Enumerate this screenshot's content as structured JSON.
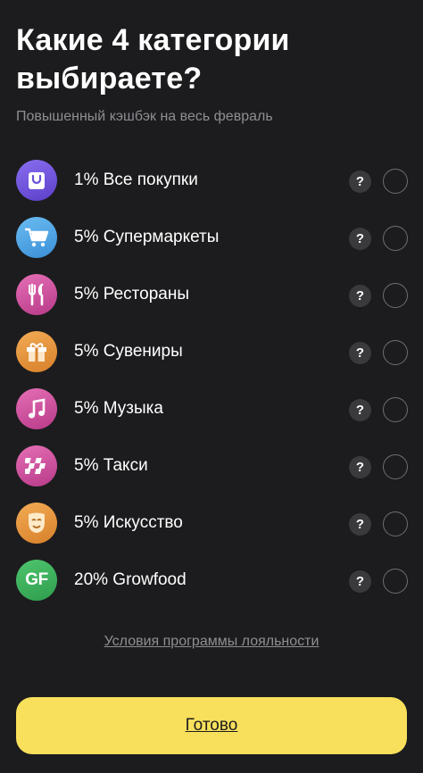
{
  "header": {
    "title": "Какие 4 категории выбираете?",
    "subtitle": "Повышенный кэшбэк на весь февраль"
  },
  "categories": [
    {
      "label": "1% Все покупки",
      "icon": "shopping-bag-icon",
      "color": "#6a4fd8"
    },
    {
      "label": "5% Супермаркеты",
      "icon": "cart-icon",
      "color": "#4aa3e6"
    },
    {
      "label": "5% Рестораны",
      "icon": "fork-knife-icon",
      "color": "#d24f9f"
    },
    {
      "label": "5% Сувениры",
      "icon": "gift-icon",
      "color": "#e69434"
    },
    {
      "label": "5% Музыка",
      "icon": "music-note-icon",
      "color": "#d24f9f"
    },
    {
      "label": "5% Такси",
      "icon": "taxi-checker-icon",
      "color": "#d24f9f"
    },
    {
      "label": "5% Искусство",
      "icon": "theater-mask-icon",
      "color": "#e69434"
    },
    {
      "label": "20% Growfood",
      "icon": "growfood-logo-icon",
      "icon_text": "GF",
      "color": "#3db35d"
    }
  ],
  "help_glyph": "?",
  "footer": {
    "loyalty_link": "Условия программы лояльности",
    "done_button": "Готово"
  },
  "colors": {
    "background": "#1c1c1e",
    "accent_button": "#f8e05c",
    "muted_text": "#8e8e93"
  }
}
